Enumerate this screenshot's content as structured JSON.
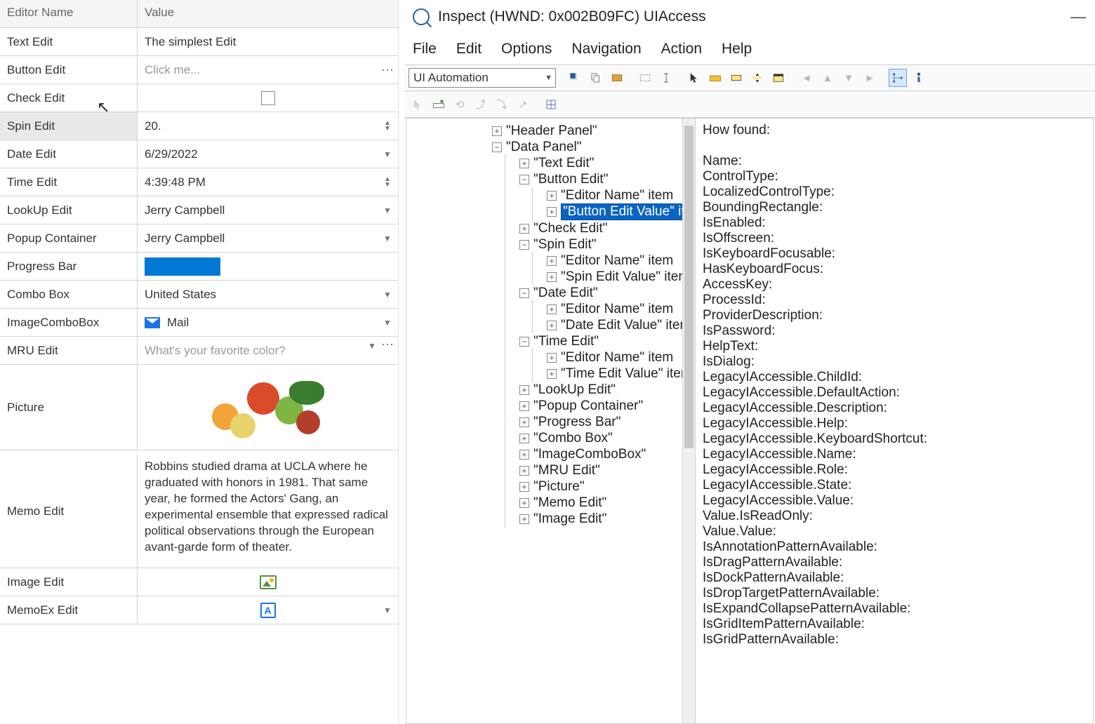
{
  "grid": {
    "headers": {
      "name": "Editor Name",
      "value": "Value"
    },
    "rows": {
      "text_edit": {
        "label": "Text Edit",
        "value": "The simplest Edit"
      },
      "button_edit": {
        "label": "Button Edit",
        "value": "Click me..."
      },
      "check_edit": {
        "label": "Check Edit"
      },
      "spin_edit": {
        "label": "Spin Edit",
        "value": "20."
      },
      "date_edit": {
        "label": "Date Edit",
        "value": "6/29/2022"
      },
      "time_edit": {
        "label": "Time Edit",
        "value": "4:39:48 PM"
      },
      "lookup_edit": {
        "label": "LookUp Edit",
        "value": "Jerry Campbell"
      },
      "popup": {
        "label": "Popup Container",
        "value": "Jerry Campbell"
      },
      "progress": {
        "label": "Progress Bar"
      },
      "combo": {
        "label": "Combo Box",
        "value": "United States"
      },
      "imgcombo": {
        "label": "ImageComboBox",
        "value": "Mail"
      },
      "mru": {
        "label": "MRU Edit",
        "value": "What's your favorite color?"
      },
      "picture": {
        "label": "Picture"
      },
      "memo": {
        "label": "Memo Edit",
        "value": "Robbins studied drama at UCLA where he graduated with honors in 1981. That same year, he formed the Actors' Gang, an experimental ensemble that expressed radical political observations through the European avant-garde form of theater."
      },
      "image_edit": {
        "label": "Image Edit"
      },
      "memoex": {
        "label": "MemoEx Edit",
        "glyph": "A"
      }
    }
  },
  "inspect": {
    "title": "Inspect  (HWND: 0x002B09FC) UIAccess",
    "menu": [
      "File",
      "Edit",
      "Options",
      "Navigation",
      "Action",
      "Help"
    ],
    "mode": "UI Automation",
    "tree": {
      "header_panel": "\"Header Panel\"",
      "data_panel": "\"Data Panel\"",
      "text_edit": "\"Text Edit\"",
      "button_edit": "\"Button Edit\"",
      "editor_name": "\"Editor Name\" item",
      "button_value": "\"Button Edit Value\" item",
      "check_edit": "\"Check Edit\"",
      "spin_edit": "\"Spin Edit\"",
      "spin_value": "\"Spin Edit Value\" item",
      "date_edit": "\"Date Edit\"",
      "date_value": "\"Date Edit Value\" item",
      "time_edit": "\"Time Edit\"",
      "time_value": "\"Time Edit Value\" item",
      "lookup": "\"LookUp Edit\"",
      "popup": "\"Popup Container\"",
      "progress": "\"Progress Bar\"",
      "combo": "\"Combo Box\"",
      "imgcombo": "\"ImageComboBox\"",
      "mru": "\"MRU Edit\"",
      "picture": "\"Picture\"",
      "memo": "\"Memo Edit\"",
      "image_edit": "\"Image Edit\""
    },
    "props": [
      "How found:",
      "",
      "Name:",
      "ControlType:",
      "LocalizedControlType:",
      "BoundingRectangle:",
      "IsEnabled:",
      "IsOffscreen:",
      "IsKeyboardFocusable:",
      "HasKeyboardFocus:",
      "AccessKey:",
      "ProcessId:",
      "ProviderDescription:",
      "IsPassword:",
      "HelpText:",
      "IsDialog:",
      "LegacyIAccessible.ChildId:",
      "LegacyIAccessible.DefaultAction:",
      "LegacyIAccessible.Description:",
      "LegacyIAccessible.Help:",
      "LegacyIAccessible.KeyboardShortcut:",
      "LegacyIAccessible.Name:",
      "LegacyIAccessible.Role:",
      "LegacyIAccessible.State:",
      "LegacyIAccessible.Value:",
      "Value.IsReadOnly:",
      "Value.Value:",
      "IsAnnotationPatternAvailable:",
      "IsDragPatternAvailable:",
      "IsDockPatternAvailable:",
      "IsDropTargetPatternAvailable:",
      "IsExpandCollapsePatternAvailable:",
      "IsGridItemPatternAvailable:",
      "IsGridPatternAvailable:"
    ]
  }
}
